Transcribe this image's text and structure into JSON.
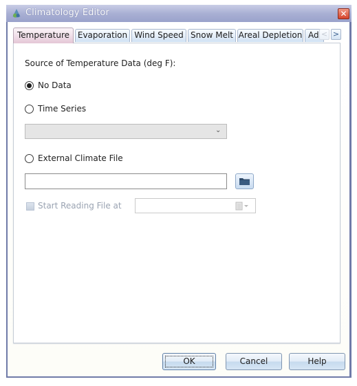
{
  "window": {
    "title": "Climatology Editor",
    "close_label": "✕"
  },
  "tabs": [
    {
      "label": "Temperature",
      "active": true
    },
    {
      "label": "Evaporation",
      "active": false
    },
    {
      "label": "Wind Speed",
      "active": false
    },
    {
      "label": "Snow Melt",
      "active": false
    },
    {
      "label": "Areal Depletion",
      "active": false
    },
    {
      "label": "Ad",
      "active": false
    }
  ],
  "tab_scroll": {
    "left": "<",
    "right": ">"
  },
  "temperature": {
    "heading": "Source of Temperature Data (deg F):",
    "options": [
      {
        "label": "No Data",
        "selected": true
      },
      {
        "label": "Time Series",
        "selected": false
      },
      {
        "label": "External Climate File",
        "selected": false
      }
    ],
    "time_series_combo": {
      "value": "",
      "chevron": "⌄"
    },
    "climate_file_path": {
      "value": ""
    },
    "start_reading": {
      "label": "Start Reading File at",
      "checked": false,
      "enabled": false,
      "date_value": ""
    }
  },
  "buttons": {
    "ok": "OK",
    "cancel": "Cancel",
    "help": "Help"
  }
}
